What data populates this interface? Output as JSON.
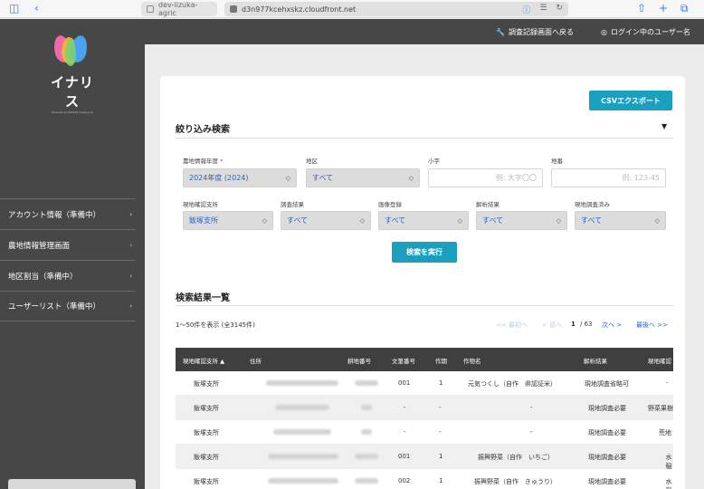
{
  "browser": {
    "tab1_title": "dev-iizuka-agric",
    "tab2_url": "d3n977kcehxskz.cloudfront.net"
  },
  "header": {
    "back_link": "調査記録画面へ戻る",
    "user_link": "ログイン中のユーザー名"
  },
  "sidebar": {
    "logo_text": "イナリス",
    "logo_sub": "Powered by BIZXIM Imaging AI",
    "items": [
      {
        "label": "アカウント情報（準備中）"
      },
      {
        "label": "農地情報管理画面"
      },
      {
        "label": "地区割当（準備中）"
      },
      {
        "label": "ユーザーリスト（準備中）"
      }
    ]
  },
  "filter": {
    "csv_label": "CSVエクスポート",
    "title": "絞り込み検索",
    "toggle": "▼",
    "fields": {
      "year_label": "農地情報年度",
      "year_required": "*",
      "year_value": "2024年度 (2024)",
      "district_label": "地区",
      "district_value": "すべて",
      "koaza_label": "小字",
      "koaza_placeholder": "例: 大字〇〇",
      "chiban_label": "地番",
      "chiban_placeholder": "例: 123-45",
      "branch_label": "現地確認支所",
      "branch_value": "飯塚支所",
      "survey_label": "調査結果",
      "survey_value": "すべて",
      "image_label": "画像登録",
      "image_value": "すべて",
      "analysis_label": "解析結果",
      "analysis_value": "すべて",
      "checked_label": "現地調査済み",
      "checked_value": "すべて"
    },
    "search_label": "検索を実行"
  },
  "results": {
    "title": "検索結果一覧",
    "count_text": "1〜50件を表示 (全3145件)",
    "pager": {
      "first": "<< 最初へ",
      "prev": "< 前へ",
      "current": "1",
      "total": "/ 63",
      "next": "次へ >",
      "last": "最後へ >>"
    },
    "columns": [
      "現地確認支所 ▲",
      "住所",
      "耕地番号",
      "文筆番号",
      "作期",
      "作物名",
      "解析結果",
      "現地確認"
    ],
    "rows": [
      {
        "branch": "飯塚支所",
        "bunpitsu": "001",
        "sakki": "1",
        "crop": "元気つくし（自作　県認証米）",
        "analysis": "現地調査省略可",
        "check": "-"
      },
      {
        "branch": "飯塚支所",
        "bunpitsu": "-",
        "sakki": "-",
        "crop": "-",
        "analysis": "現地調査必要",
        "check": "野菜果樹"
      },
      {
        "branch": "飯塚支所",
        "bunpitsu": "-",
        "sakki": "-",
        "crop": "-",
        "analysis": "現地調査必要",
        "check": "荒地"
      },
      {
        "branch": "飯塚支所",
        "bunpitsu": "001",
        "sakki": "1",
        "crop": "振興野菜（自作　いちご）",
        "analysis": "現地調査必要",
        "check": "水稲"
      },
      {
        "branch": "飯塚支所",
        "bunpitsu": "002",
        "sakki": "1",
        "crop": "振興野菜（自作　きゅうり）",
        "analysis": "現地調査必要",
        "check": "水稲"
      }
    ]
  }
}
